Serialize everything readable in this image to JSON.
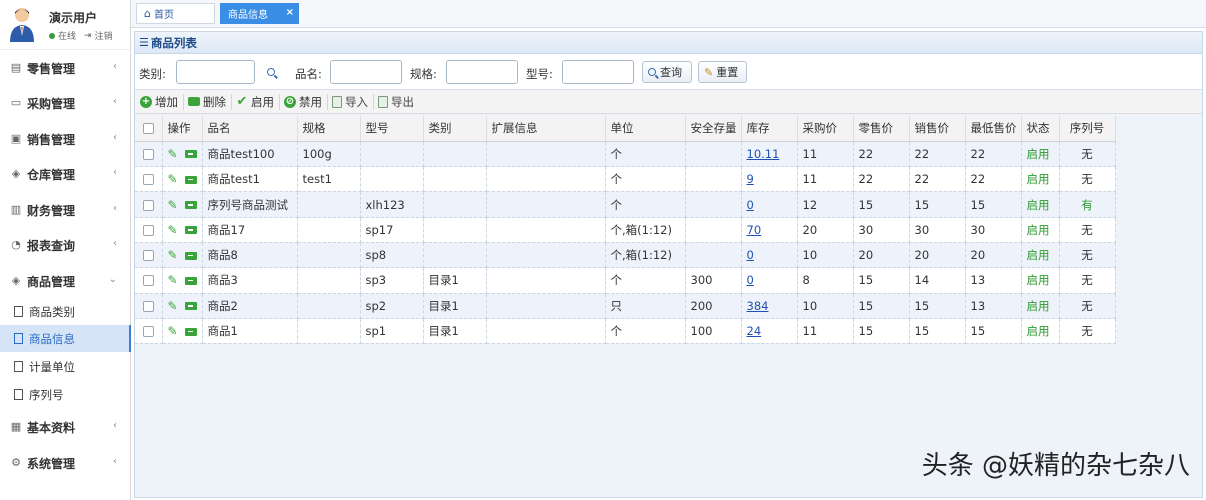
{
  "user": {
    "name": "演示用户",
    "status": "在线",
    "logout": "注销"
  },
  "menu": [
    {
      "label": "零售管理",
      "icon": "retail-icon"
    },
    {
      "label": "采购管理",
      "icon": "purchase-icon"
    },
    {
      "label": "销售管理",
      "icon": "sales-icon"
    },
    {
      "label": "仓库管理",
      "icon": "warehouse-icon"
    },
    {
      "label": "财务管理",
      "icon": "finance-icon"
    },
    {
      "label": "报表查询",
      "icon": "report-icon"
    },
    {
      "label": "商品管理",
      "icon": "goods-icon"
    },
    {
      "label": "基本资料",
      "icon": "basic-icon"
    },
    {
      "label": "系统管理",
      "icon": "system-icon"
    }
  ],
  "submenu": [
    {
      "label": "商品类别"
    },
    {
      "label": "商品信息"
    },
    {
      "label": "计量单位"
    },
    {
      "label": "序列号"
    }
  ],
  "tabs": {
    "home": "首页",
    "active": "商品信息",
    "close": "×"
  },
  "panel": {
    "title": "商品列表"
  },
  "search": {
    "category_label": "类别:",
    "name_label": "品名:",
    "spec_label": "规格:",
    "model_label": "型号:",
    "query": "查询",
    "reset": "重置"
  },
  "toolbar": {
    "add": "增加",
    "delete": "删除",
    "enable": "启用",
    "disable": "禁用",
    "import": "导入",
    "export": "导出"
  },
  "table": {
    "headers": [
      "",
      "操作",
      "品名",
      "规格",
      "型号",
      "类别",
      "扩展信息",
      "单位",
      "安全存量",
      "库存",
      "采购价",
      "零售价",
      "销售价",
      "最低售价",
      "状态",
      "序列号"
    ],
    "rows": [
      {
        "name": "商品test100",
        "spec": "100g",
        "model": "",
        "category": "",
        "ext": "",
        "unit": "个",
        "safety": "",
        "stock": "10.11",
        "purchase": "11",
        "retail": "22",
        "sale": "22",
        "min": "22",
        "status": "启用",
        "serial": "无"
      },
      {
        "name": "商品test1",
        "spec": "test1",
        "model": "",
        "category": "",
        "ext": "",
        "unit": "个",
        "safety": "",
        "stock": "9",
        "purchase": "11",
        "retail": "22",
        "sale": "22",
        "min": "22",
        "status": "启用",
        "serial": "无"
      },
      {
        "name": "序列号商品测试",
        "spec": "",
        "model": "xlh123",
        "category": "",
        "ext": "",
        "unit": "个",
        "safety": "",
        "stock": "0",
        "purchase": "12",
        "retail": "15",
        "sale": "15",
        "min": "15",
        "status": "启用",
        "serial": "有"
      },
      {
        "name": "商品17",
        "spec": "",
        "model": "sp17",
        "category": "",
        "ext": "",
        "unit": "个,箱(1:12)",
        "safety": "",
        "stock": "70",
        "purchase": "20",
        "retail": "30",
        "sale": "30",
        "min": "30",
        "status": "启用",
        "serial": "无"
      },
      {
        "name": "商品8",
        "spec": "",
        "model": "sp8",
        "category": "",
        "ext": "",
        "unit": "个,箱(1:12)",
        "safety": "",
        "stock": "0",
        "purchase": "10",
        "retail": "20",
        "sale": "20",
        "min": "20",
        "status": "启用",
        "serial": "无"
      },
      {
        "name": "商品3",
        "spec": "",
        "model": "sp3",
        "category": "目录1",
        "ext": "",
        "unit": "个",
        "safety": "300",
        "stock": "0",
        "purchase": "8",
        "retail": "15",
        "sale": "14",
        "min": "13",
        "status": "启用",
        "serial": "无"
      },
      {
        "name": "商品2",
        "spec": "",
        "model": "sp2",
        "category": "目录1",
        "ext": "",
        "unit": "只",
        "safety": "200",
        "stock": "384",
        "purchase": "10",
        "retail": "15",
        "sale": "15",
        "min": "13",
        "status": "启用",
        "serial": "无"
      },
      {
        "name": "商品1",
        "spec": "",
        "model": "sp1",
        "category": "目录1",
        "ext": "",
        "unit": "个",
        "safety": "100",
        "stock": "24",
        "purchase": "11",
        "retail": "15",
        "sale": "15",
        "min": "15",
        "status": "启用",
        "serial": "无"
      }
    ]
  },
  "watermark": "头条 @妖精的杂七杂八",
  "colors": {
    "accent": "#3a8ee6",
    "status_green": "#2e9a2e",
    "link": "#2150b3"
  }
}
